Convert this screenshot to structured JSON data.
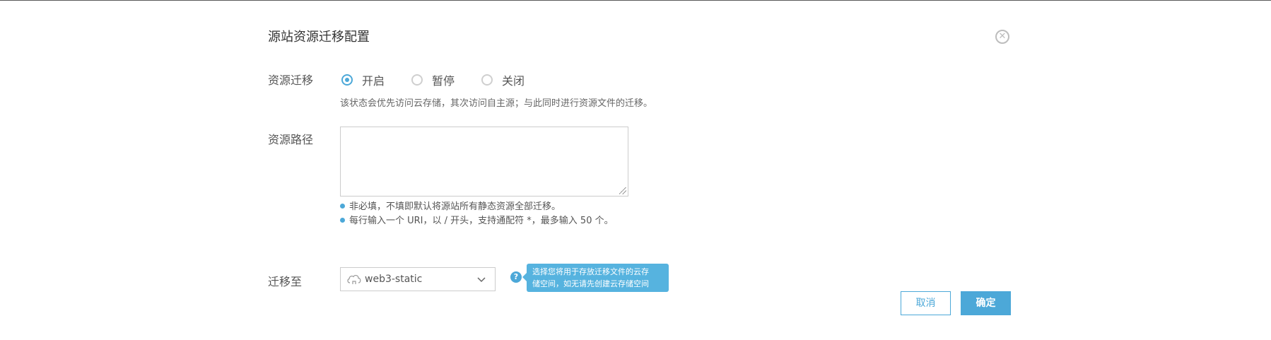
{
  "dialog": {
    "title": "源站资源迁移配置",
    "close_icon_glyph": "✕"
  },
  "migration": {
    "label": "资源迁移",
    "options": [
      {
        "label": "开启",
        "selected": true
      },
      {
        "label": "暂停",
        "selected": false
      },
      {
        "label": "关闭",
        "selected": false
      }
    ],
    "help": "该状态会优先访问云存储，其次访问自主源；与此同时进行资源文件的迁移。"
  },
  "path": {
    "label": "资源路径",
    "value": "",
    "placeholder": "",
    "notes": [
      "非必填，不填即默认将源站所有静态资源全部迁移。",
      "每行输入一个 URI，以 / 开头，支持通配符 *，最多输入 50 个。"
    ]
  },
  "target": {
    "label": "迁移至",
    "selected_value": "web3-static",
    "help_icon_glyph": "?",
    "tooltip_line1": "选择您将用于存放迁移文件的云存",
    "tooltip_line2": "储空间，如无请先创建云存储空间"
  },
  "buttons": {
    "cancel": "取消",
    "ok": "确定"
  },
  "colors": {
    "accent": "#4ca8d8",
    "tooltip_bg": "#56b3df",
    "border": "#cccccc"
  }
}
